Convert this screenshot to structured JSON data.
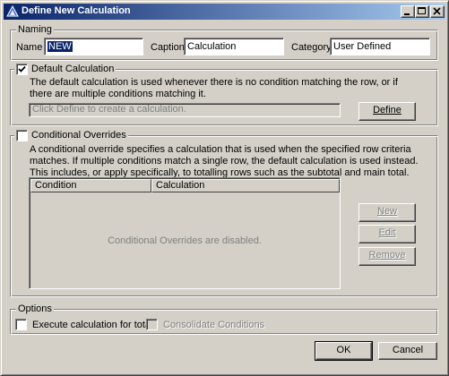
{
  "window": {
    "title": "Define New Calculation"
  },
  "naming": {
    "legend": "Naming",
    "name_label": "Name",
    "name_value": "NEW",
    "caption_label": "Caption",
    "caption_value": "Calculation",
    "category_label": "Category",
    "category_value": "User Defined"
  },
  "default_calc": {
    "legend": "Default Calculation",
    "checked": true,
    "description": "The default calculation is used whenever there is no condition matching the row, or if there are multiple conditions matching it.",
    "expression_placeholder": "Click Define to create a calculation.",
    "define_button": "Define"
  },
  "overrides": {
    "legend": "Conditional Overrides",
    "checked": false,
    "description": "A conditional override specifies a calculation that is used when the specified row criteria matches. If multiple conditions match a single row, the default calculation is used instead. This includes, or apply specifically, to totalling rows such as the subtotal and main total.",
    "columns": [
      "Condition",
      "Calculation"
    ],
    "empty_message": "Conditional Overrides are disabled.",
    "new_button": "New",
    "edit_button": "Edit",
    "remove_button": "Remove"
  },
  "options": {
    "legend": "Options",
    "execute_totals_label": "Execute calculation for totals",
    "execute_totals_checked": false,
    "consolidate_label": "Consolidate Conditions",
    "consolidate_checked": false
  },
  "footer": {
    "ok_button": "OK",
    "cancel_button": "Cancel"
  }
}
